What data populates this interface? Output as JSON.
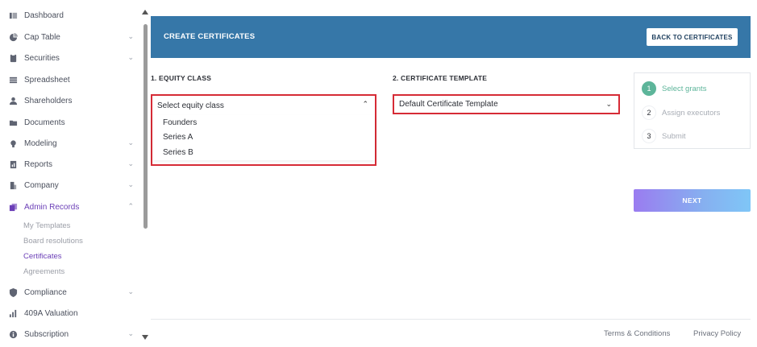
{
  "sidebar": {
    "items": [
      {
        "label": "Dashboard",
        "icon": "dashboard-icon",
        "has_chevron": false
      },
      {
        "label": "Cap Table",
        "icon": "pie-chart-icon",
        "has_chevron": true
      },
      {
        "label": "Securities",
        "icon": "clipboard-icon",
        "has_chevron": true
      },
      {
        "label": "Spreadsheet",
        "icon": "spreadsheet-icon",
        "has_chevron": false
      },
      {
        "label": "Shareholders",
        "icon": "person-icon",
        "has_chevron": false
      },
      {
        "label": "Documents",
        "icon": "folder-icon",
        "has_chevron": false
      },
      {
        "label": "Modeling",
        "icon": "lightbulb-icon",
        "has_chevron": true
      },
      {
        "label": "Reports",
        "icon": "report-icon",
        "has_chevron": true
      },
      {
        "label": "Company",
        "icon": "building-icon",
        "has_chevron": true
      },
      {
        "label": "Admin Records",
        "icon": "records-icon",
        "has_chevron": true,
        "active": true
      },
      {
        "label": "Compliance",
        "icon": "shield-icon",
        "has_chevron": true
      },
      {
        "label": "409A Valuation",
        "icon": "valuation-icon",
        "has_chevron": false
      },
      {
        "label": "Subscription",
        "icon": "info-icon",
        "has_chevron": true
      }
    ],
    "admin_sub_items": [
      {
        "label": "My Templates"
      },
      {
        "label": "Board resolutions"
      },
      {
        "label": "Certificates",
        "active": true
      },
      {
        "label": "Agreements"
      }
    ]
  },
  "header": {
    "title": "CREATE CERTIFICATES",
    "back_button": "BACK TO CERTIFICATES"
  },
  "equity_class": {
    "section_label": "1. EQUITY CLASS",
    "placeholder": "Select equity class",
    "options": [
      "Founders",
      "Series A",
      "Series B"
    ]
  },
  "certificate_template": {
    "section_label": "2. CERTIFICATE TEMPLATE",
    "selected": "Default Certificate Template"
  },
  "steps": [
    {
      "number": "1",
      "label": "Select grants",
      "active": true
    },
    {
      "number": "2",
      "label": "Assign executors",
      "active": false
    },
    {
      "number": "3",
      "label": "Submit",
      "active": false
    }
  ],
  "next_button": "NEXT",
  "footer": {
    "terms": "Terms & Conditions",
    "privacy": "Privacy Policy"
  },
  "colors": {
    "accent_purple": "#6b3fb7",
    "header_blue": "#3677a8",
    "highlight_red": "#d62b36",
    "step_green": "#5db59a"
  }
}
